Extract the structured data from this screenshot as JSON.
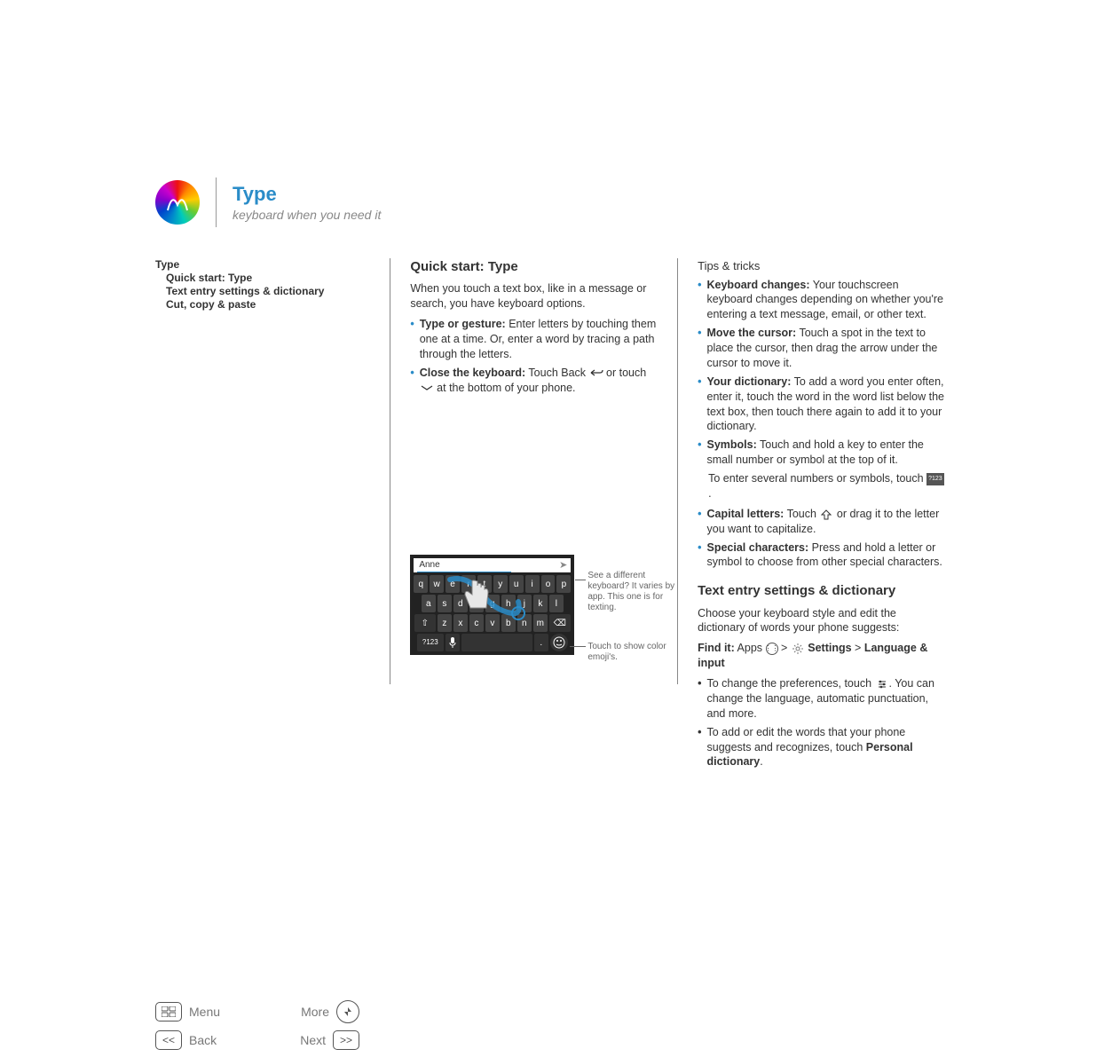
{
  "header": {
    "title": "Type",
    "subtitle": "keyboard when you need it"
  },
  "toc": {
    "title": "Type",
    "items": [
      "Quick start: Type",
      "Text entry settings & dictionary",
      "Cut, copy & paste"
    ]
  },
  "nav": {
    "menu": "Menu",
    "more": "More",
    "back": "Back",
    "next": "Next"
  },
  "mid": {
    "h1": "Quick start: Type",
    "intro": "When you touch a text box, like in a message or search, you have keyboard options.",
    "b1_strong": "Type or gesture:",
    "b1_text": " Enter letters by touching them one at a time. Or, enter a word by tracing a path through the letters.",
    "b2_strong": "Close the keyboard:",
    "b2_pre": " Touch Back ",
    "b2_mid": " or touch ",
    "b2_post": " at the bottom of your phone.",
    "callout1": "See a different keyboard? It varies by app. This one is for texting.",
    "callout2": "Touch to show color emoji's.",
    "input_text": "Anne"
  },
  "keys": {
    "r1": [
      "q",
      "w",
      "e",
      "r",
      "t",
      "y",
      "u",
      "i",
      "o",
      "p"
    ],
    "r2": [
      "a",
      "s",
      "d",
      "f",
      "g",
      "h",
      "j",
      "k",
      "l"
    ],
    "r3": [
      "z",
      "x",
      "c",
      "v",
      "b",
      "n",
      "m"
    ],
    "shift": "⇧",
    "bksp": "⌫",
    "num": "?123",
    "mic": "🎤",
    "dot": ".",
    "emoji": "☺"
  },
  "right": {
    "tips_h": "Tips & tricks",
    "t1_s": "Keyboard changes:",
    "t1": " Your touchscreen keyboard changes depending on whether you're entering a text message, email, or other text.",
    "t2_s": "Move the cursor:",
    "t2": " Touch a spot in the text to place the cursor, then drag the arrow under the cursor to move it.",
    "t3_s": "Your dictionary:",
    "t3": " To add a word you enter often, enter it, touch the word in the word list below the text box, then touch there again to add it to your dictionary.",
    "t4_s": "Symbols:",
    "t4": " Touch and hold a key to enter the small number or symbol at the top of it.",
    "t4_extra_pre": "To enter several numbers or symbols, touch ",
    "t4_extra_post": ".",
    "t5_s": "Capital letters:",
    "t5_pre": " Touch ",
    "t5_post": " or drag it to the letter you want to capitalize.",
    "t6_s": "Special characters:",
    "t6": " Press and hold a letter or symbol to choose from other special characters.",
    "h2": "Text entry settings & dictionary",
    "h2_intro": "Choose your keyboard style and edit the dictionary of words your phone suggests:",
    "findit": "Find it:",
    "findit_apps": " Apps ",
    "findit_arrow": " > ",
    "findit_settings": " Settings",
    "findit_arrow2": " > ",
    "findit_lang": "Language & input",
    "p1_pre": "To change the preferences, touch ",
    "p1_post": ". You can change the language, automatic punctuation, and more.",
    "p2_pre": "To add or edit the words that your phone suggests and recognizes, touch ",
    "p2_strong": "Personal dictionary",
    "p2_post": "."
  }
}
